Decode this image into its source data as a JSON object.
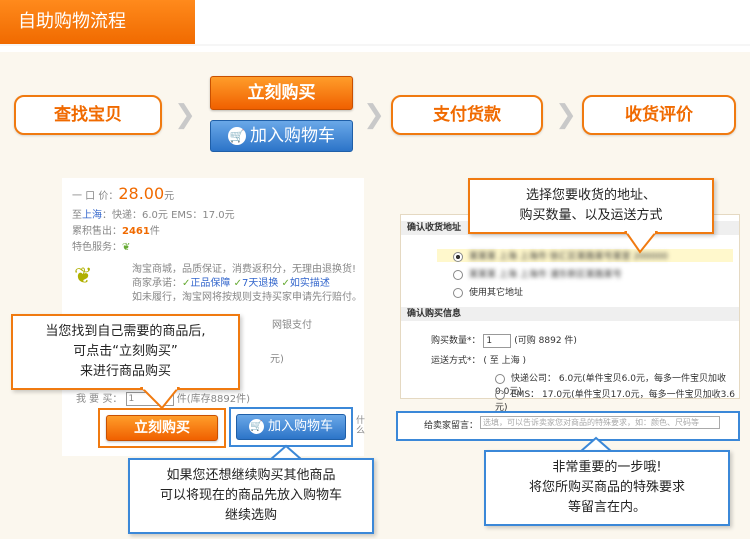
{
  "header": {
    "title": "自助购物流程"
  },
  "steps": {
    "find": "查找宝贝",
    "buy_now": "立刻购买",
    "add_cart": "加入购物车",
    "pay": "支付货款",
    "review": "收货评价"
  },
  "product": {
    "price_label": "一 口 价：",
    "price": "28.00",
    "price_unit": "元",
    "ship_from": "至",
    "ship_region": "上海",
    "ship_detail": "：快递：6.0元   EMS：17.0元",
    "sold_label": "累积售出：",
    "sold_count": "2461",
    "sold_unit": "件",
    "service_label": "特色服务：",
    "promise_1": "淘宝商城，品质保证，消费返积分，无理由退换货!",
    "promise_2": "商家承诺：",
    "promise_tag_1": "正品保障",
    "promise_tag_2": "7天退换",
    "promise_tag_3": "如实描述",
    "promise_3": "如未履行，淘宝网将按规则支持买家申请先行赔付。",
    "partial_1": "网银支付",
    "partial_2": "元)",
    "qty_label": "我 要 买：",
    "qty_value": "1",
    "stock": "件(库存8892件)",
    "buy_btn": "立刻购买",
    "cart_btn": "加入购物车",
    "side_cut": "什么"
  },
  "callouts": {
    "buy_tip": [
      "当您找到自己需要的商品后,",
      "可点击“立刻购买”",
      "来进行商品购买"
    ],
    "cart_tip": [
      "如果您还想继续购买其他商品",
      "可以将现在的商品先放入购物车",
      "继续选购"
    ],
    "address_tip": [
      "选择您要收货的地址、",
      "购买数量、以及运送方式"
    ],
    "note_tip": [
      "非常重要的一步哦!",
      "将您所购买商品的特殊要求",
      "等留言在内。"
    ]
  },
  "order": {
    "address_header": "确认收货地址",
    "addr_1": "某某某   上海 上海市 徐汇区某路某号某室 200000",
    "addr_2": "某某某   上海 上海市 浦东新区某路某号",
    "addr_other": "使用其它地址",
    "info_header": "确认购买信息",
    "qty_label": "购买数量*：",
    "qty_value": "1",
    "qty_stock": "(可购 8892 件)",
    "ship_label": "运送方式*：",
    "ship_to": "( 至 上海 )",
    "ship_express": "快递公司：  6.0元(单件宝贝6.0元，每多一件宝贝加收0.0元)",
    "ship_ems": "EMS：  17.0元(单件宝贝17.0元，每多一件宝贝加收3.6元)",
    "note_label": "给卖家留言：",
    "note_placeholder": "选填，可以告诉卖家您对商品的特殊要求，如：颜色、尺码等"
  }
}
